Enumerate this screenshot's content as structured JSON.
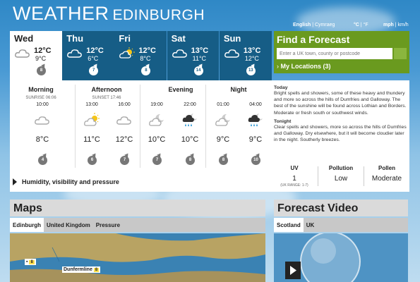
{
  "header": {
    "title": "WEATHER",
    "location": "Edinburgh"
  },
  "language": {
    "english": "English",
    "welsh": "Cymraeg"
  },
  "units": {
    "temp_c": "°C",
    "temp_f": "°F",
    "speed_mph": "mph",
    "speed_kmh": "km/h"
  },
  "days": [
    {
      "name": "Wed",
      "high": "12°C",
      "low": "9°C",
      "wind": "8",
      "icon": "cloud-icon"
    },
    {
      "name": "Thu",
      "high": "12°C",
      "low": "6°C",
      "wind": "7",
      "icon": "cloud-icon"
    },
    {
      "name": "Fri",
      "high": "12°C",
      "low": "8°C",
      "wind": "8",
      "icon": "sun-cloud-icon"
    },
    {
      "name": "Sat",
      "high": "13°C",
      "low": "11°C",
      "wind": "14",
      "icon": "cloud-icon"
    },
    {
      "name": "Sun",
      "high": "13°C",
      "low": "12°C",
      "wind": "13",
      "icon": "cloud-icon"
    }
  ],
  "find_forecast": {
    "title": "Find a Forecast",
    "placeholder": "Enter a UK town, county or postcode",
    "my_locations": "My Locations (3)"
  },
  "periods": {
    "morning": "Morning",
    "afternoon": "Afternoon",
    "evening": "Evening",
    "night": "Night",
    "sunrise": "SUNRISE 06:06",
    "sunset": "SUNSET 17:46"
  },
  "slots": [
    {
      "time": "10:00",
      "temp": "8°C",
      "wind": "4",
      "icon": "cloud-icon"
    },
    {
      "time": "13:00",
      "temp": "11°C",
      "wind": "6",
      "icon": "sun-cloud-icon"
    },
    {
      "time": "16:00",
      "temp": "12°C",
      "wind": "7",
      "icon": "cloud-icon"
    },
    {
      "time": "19:00",
      "temp": "10°C",
      "wind": "7",
      "icon": "moon-cloud-icon"
    },
    {
      "time": "22:00",
      "temp": "10°C",
      "wind": "8",
      "icon": "rain-cloud-icon"
    },
    {
      "time": "01:00",
      "temp": "9°C",
      "wind": "8",
      "icon": "moon-cloud-icon"
    },
    {
      "time": "04:00",
      "temp": "9°C",
      "wind": "10",
      "icon": "rain-cloud-icon"
    }
  ],
  "forecast": {
    "today_heading": "Today",
    "today_text": "Bright spells and showers, some of these heavy and thundery and more so across the hills of Dumfries and Galloway. The best of the sunshine will be found across Lothian and Borders. Moderate or fresh south or southwest winds.",
    "tonight_heading": "Tonight",
    "tonight_text": "Clear spells and showers, more so across the hills of Dumfries and Galloway. Dry elsewhere, but it will become cloudier later in the night. Southerly breezes."
  },
  "conditions": {
    "uv_label": "UV",
    "uv_value": "1",
    "uv_range": "(UK RANGE: 1-7)",
    "pollution_label": "Pollution",
    "pollution_value": "Low",
    "pollen_label": "Pollen",
    "pollen_value": "Moderate"
  },
  "humidity_link": "Humidity, visibility and pressure",
  "maps": {
    "title": "Maps",
    "tabs": [
      "Edinburgh",
      "United Kingdom",
      "Pressure"
    ],
    "label_first": "8",
    "label_dunfermline": "Dunfermline",
    "label_dunfermline_val": "8"
  },
  "video": {
    "title": "Forecast Video",
    "tabs": [
      "Scotland",
      "UK"
    ]
  }
}
